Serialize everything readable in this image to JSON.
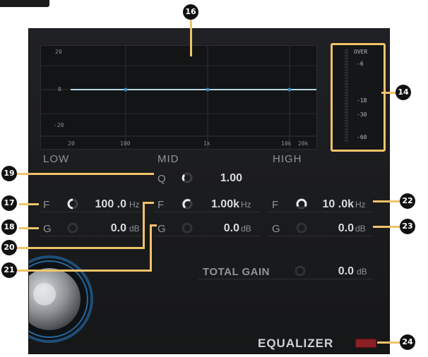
{
  "graph": {
    "y_ticks": [
      "20",
      "0",
      "-20"
    ],
    "x_ticks": [
      "20",
      "100",
      "1k",
      "10k",
      "20k"
    ]
  },
  "meter": {
    "labels": [
      "OVER",
      "-6",
      "-18",
      "-30",
      "-60"
    ]
  },
  "bands": {
    "low": {
      "title": "LOW",
      "freq": {
        "letter": "F",
        "value": "100 .0",
        "unit": "Hz"
      },
      "gain": {
        "letter": "G",
        "value": "0.0",
        "unit": "dB"
      }
    },
    "mid": {
      "title": "MID",
      "q": {
        "letter": "Q",
        "value": "1.00"
      },
      "freq": {
        "letter": "F",
        "value": "1.00k",
        "unit": "Hz"
      },
      "gain": {
        "letter": "G",
        "value": "0.0",
        "unit": "dB"
      }
    },
    "high": {
      "title": "HIGH",
      "freq": {
        "letter": "F",
        "value": "10 .0k",
        "unit": "Hz"
      },
      "gain": {
        "letter": "G",
        "value": "0.0",
        "unit": "dB"
      }
    }
  },
  "total_gain": {
    "label": "TOTAL GAIN",
    "value": "0.0",
    "unit": "dB"
  },
  "equalizer": {
    "label": "EQUALIZER"
  },
  "callouts": {
    "graph": "16",
    "meter": "14",
    "mid_q": "19",
    "low_freq": "17",
    "low_gain": "18",
    "mid_freq": "20",
    "mid_gain": "21",
    "high_freq": "22",
    "high_gain": "23",
    "eq_switch": "24"
  },
  "colors": {
    "accent": "#f0c36a",
    "panel": "#1d1e20",
    "indicator_off": "#8a1f24",
    "knob_glow": "#2a7fc0"
  }
}
